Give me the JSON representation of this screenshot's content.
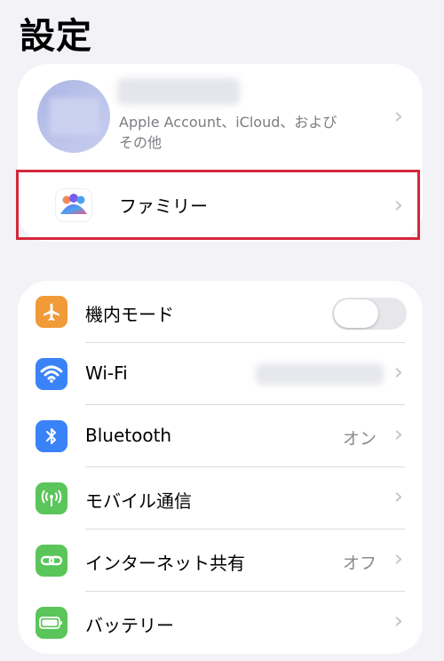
{
  "page": {
    "title": "設定"
  },
  "account": {
    "subtitle": "Apple Account、iCloud、および\nその他"
  },
  "family": {
    "label": "ファミリー"
  },
  "settings": {
    "airplane": {
      "label": "機内モード",
      "on": false
    },
    "wifi": {
      "label": "Wi-Fi"
    },
    "bluetooth": {
      "label": "Bluetooth",
      "value": "オン"
    },
    "cellular": {
      "label": "モバイル通信"
    },
    "hotspot": {
      "label": "インターネット共有",
      "value": "オフ"
    },
    "battery": {
      "label": "バッテリー"
    }
  },
  "colors": {
    "airplane": "#f19a38",
    "wifi": "#3a82f7",
    "bluetooth": "#3a82f7",
    "cellular": "#5ac55a",
    "hotspot": "#5ac55a",
    "battery": "#5ac55a",
    "highlight": "#d3283a"
  },
  "icons": {
    "airplane": "airplane-icon",
    "wifi": "wifi-icon",
    "bluetooth": "bluetooth-icon",
    "cellular": "cellular-antenna-icon",
    "hotspot": "link-chain-icon",
    "battery": "battery-icon",
    "family": "family-people-icon",
    "chevron": "chevron-right-icon"
  }
}
